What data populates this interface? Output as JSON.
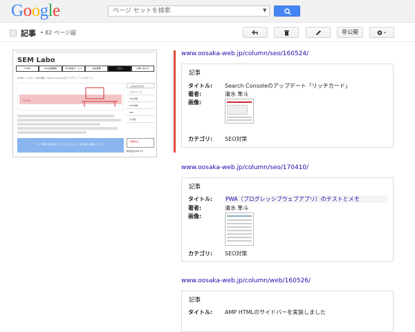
{
  "topbar": {
    "logo_letters": [
      {
        "ch": "G",
        "color": "#4285f4"
      },
      {
        "ch": "o",
        "color": "#ea4335"
      },
      {
        "ch": "o",
        "color": "#fbbc05"
      },
      {
        "ch": "g",
        "color": "#4285f4"
      },
      {
        "ch": "l",
        "color": "#34a853"
      },
      {
        "ch": "e",
        "color": "#ea4335"
      }
    ],
    "search_placeholder": "ページ セットを検索",
    "search_icon": "magnifier-icon"
  },
  "subbar": {
    "title": "記事",
    "count": "• 82 ページ超",
    "buttons": {
      "undo_icon": "undo-arrow-icon",
      "delete_icon": "trash-icon",
      "edit_icon": "pencil-icon",
      "private_label": "非公開",
      "settings_icon": "gear-icon"
    }
  },
  "preview": {
    "logo": "SEM Labo",
    "nav": [
      "HOME",
      "SEO対策業務",
      "SEO関連サービス",
      "会社概要",
      "コラム",
      "お問い合わせ"
    ],
    "crumb": "HOME > コラム > SEO対策 > Search Consoleのアップデート「リッチカード」",
    "hero_label": "コラム",
    "side_head": "コラムカテゴリ",
    "side_items": [
      "コラムトップ",
      "SEO対策",
      "SEO対策",
      "SNS",
      "その他"
    ],
    "blue_text": "ウェブ集客でお困りのことがございましたら、お気軽にご相談ください。",
    "contact": "ご相談窓口",
    "company": "株式会社SEMラボ"
  },
  "results": [
    {
      "url": "www.oosaka-web.jp/column/seo/160524/",
      "card_title": "記事",
      "labels": {
        "title": "タイトル:",
        "author": "著者:",
        "image": "画像:",
        "category": "カテゴリ:"
      },
      "title": "Search Consoleのアップデート「リッチカード」",
      "author": "清水 隼斗",
      "category": "SEO対策",
      "selected": true
    },
    {
      "url": "www.oosaka-web.jp/column/seo/170410/",
      "card_title": "記事",
      "labels": {
        "title": "タイトル:",
        "author": "著者:",
        "image": "画像:",
        "category": "カテゴリ:"
      },
      "title": "PWA（プログレッシブウェブアプリ）のテストとメモ",
      "author": "清水 隼斗",
      "category": "SEO対策",
      "selected": false
    },
    {
      "url": "www.oosaka-web.jp/column/web/160526/",
      "card_title": "記事",
      "labels": {
        "title": "タイトル:"
      },
      "title": "AMP HTMLのサイドバーを実装しました",
      "selected": false
    }
  ]
}
